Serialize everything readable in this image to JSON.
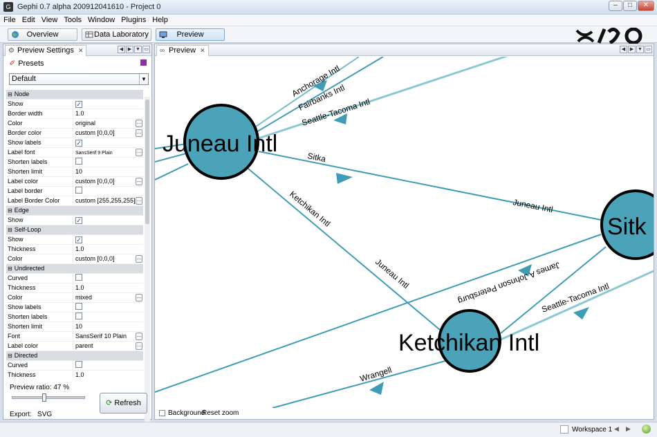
{
  "window": {
    "title": "Gephi 0.7 alpha 200912041610 - Project 0"
  },
  "menu": [
    "File",
    "Edit",
    "View",
    "Tools",
    "Window",
    "Plugins",
    "Help"
  ],
  "workspace_tabs": {
    "overview": "Overview",
    "data_lab": "Data Laboratory",
    "preview": "Preview"
  },
  "left_panel": {
    "tab_label": "Preview Settings",
    "presets_label": "Presets",
    "preset_value": "Default",
    "ratio_label": "Preview ratio:",
    "ratio_value": "47 %",
    "refresh_label": "Refresh",
    "export_label": "Export:",
    "export_value": "SVG"
  },
  "properties": [
    {
      "cat": "Node"
    },
    {
      "k": "Show",
      "cb": true
    },
    {
      "k": "Border width",
      "v": "1.0"
    },
    {
      "k": "Color",
      "v": "original",
      "more": true
    },
    {
      "k": "Border color",
      "v": "custom [0,0,0]",
      "more": true
    },
    {
      "k": "Show labels",
      "cb": true
    },
    {
      "k": "Label font",
      "v": "SansSerif 9 Plain",
      "small": true,
      "more": true
    },
    {
      "k": "Shorten labels",
      "cb": false
    },
    {
      "k": "Shorten limit",
      "v": "10"
    },
    {
      "k": "Label color",
      "v": "custom [0,0,0]",
      "more": true
    },
    {
      "k": "Label border",
      "cb": false
    },
    {
      "k": "Label Border Color",
      "v": "custom [255,255,255]",
      "more": true
    },
    {
      "cat": "Edge"
    },
    {
      "k": "Show",
      "cb": true
    },
    {
      "cat": "Self-Loop"
    },
    {
      "k": "Show",
      "cb": true
    },
    {
      "k": "Thickness",
      "v": "1.0"
    },
    {
      "k": "Color",
      "v": "custom [0,0,0]",
      "more": true
    },
    {
      "cat": "Undirected"
    },
    {
      "k": "Curved",
      "cb": false
    },
    {
      "k": "Thickness",
      "v": "1.0"
    },
    {
      "k": "Color",
      "v": "mixed",
      "more": true
    },
    {
      "k": "Show labels",
      "cb": false
    },
    {
      "k": "Shorten labels",
      "cb": false
    },
    {
      "k": "Shorten limit",
      "v": "10"
    },
    {
      "k": "Font",
      "v": "SansSerif 10 Plain",
      "more": true
    },
    {
      "k": "Label color",
      "v": "parent",
      "more": true
    },
    {
      "cat": "Directed"
    },
    {
      "k": "Curved",
      "cb": false
    },
    {
      "k": "Thickness",
      "v": "1.0"
    }
  ],
  "preview_panel": {
    "tab_label": "Preview",
    "background_label": "Background",
    "reset_zoom_label": "Reset zoom"
  },
  "graph": {
    "nodes": {
      "juneau": "Juneau Intl",
      "ketchikan": "Ketchikan Intl",
      "sitka": "Sitk"
    },
    "edge_labels": {
      "anchorage": "Anchorage Intl",
      "fairbanks": "Fairbanks Intl",
      "seattle_top": "Seattle-Tacoma Intl",
      "sitka_edge": "Sitka",
      "juneau_to_sitka": "Juneau Intl",
      "ketchikan_edge": "Ketchikan Intl",
      "juneau_from_ketch": "Juneau Intl",
      "james": "James A Johnson Petersburg",
      "seattle_bottom": "Seattle-Tacoma Intl",
      "wrangell": "Wrangell"
    },
    "node_color": "#4aa3b8",
    "edge_color": "#3f9cb4"
  },
  "status": {
    "workspace": "Workspace 1"
  }
}
